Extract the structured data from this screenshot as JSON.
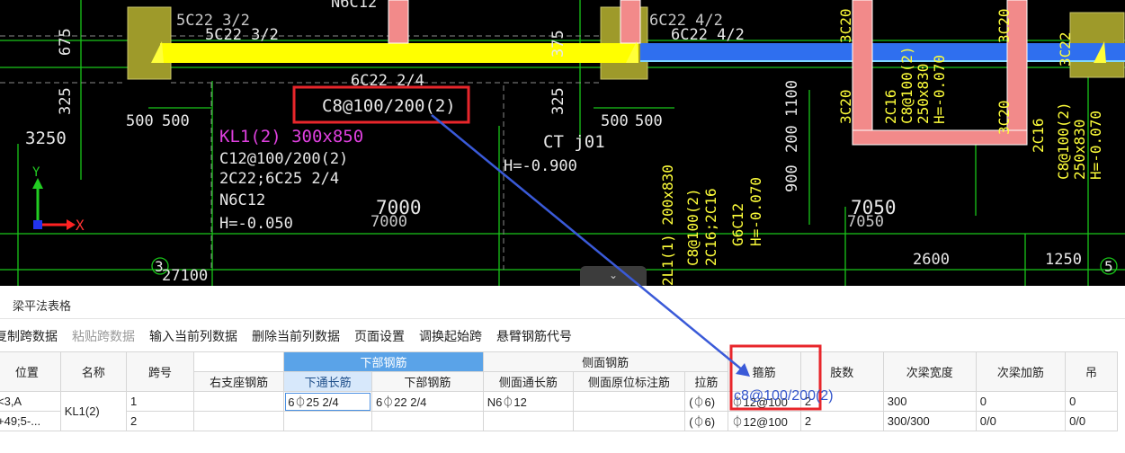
{
  "cad": {
    "labels": {
      "l1": "5C22 3/2",
      "l2": "5C22 3/2",
      "l3": "6C22 4/2",
      "l4": "6C22 4/2",
      "l5": "675",
      "l6": "325",
      "l7": "3250",
      "l8": "500",
      "l9": "500",
      "l10": "500",
      "l11": "500",
      "l12": "6C22 2/4",
      "l13": "C8@100/200(2)",
      "l14": "KL1(2) 300x850",
      "l15": "C12@100/200(2)",
      "l16": "2C22;6C25 2/4",
      "l17": "N6C12",
      "l18": "H=-0.050",
      "l19": "7000",
      "l20": "7000",
      "l21": "CT j01",
      "l22": "H=-0.900",
      "l23": "375",
      "l24": "325",
      "l25": "1100",
      "l26": "200",
      "l27": "900",
      "l28": "7050",
      "l29": "7050",
      "l30": "2600",
      "l31": "1250",
      "l32": "27100",
      "l33": "3",
      "l34": "5",
      "l35": "N6C12",
      "l36": "3C20",
      "l37": "3C20",
      "l38": "3C22",
      "l39": "2C16",
      "l40": "C8@100(2)",
      "l41": "250x830",
      "l42": "H=-0.070",
      "l43": "G6C12",
      "l44": "H=-0.070",
      "l45": "2C16;2C16",
      "l46": "C8@100(2)",
      "l47": "2L1(1) 200x830",
      "l48": "X",
      "l49": "Y"
    }
  },
  "panel": {
    "title": "梁平法表格",
    "toolbar": [
      "复制跨数据",
      "粘贴跨数据",
      "输入当前列数据",
      "删除当前列数据",
      "页面设置",
      "调换起始跨",
      "悬臂钢筋代号"
    ],
    "group_headers": {
      "bottom": "下部钢筋",
      "side": "侧面钢筋"
    },
    "columns": [
      "位置",
      "名称",
      "跨号",
      "右支座钢筋",
      "下通长筋",
      "下部钢筋",
      "侧面通长筋",
      "侧面原位标注筋",
      "拉筋",
      "箍筋",
      "肢数",
      "次梁宽度",
      "次梁加筋",
      "吊"
    ],
    "rows": [
      {
        "pos": "<3,A",
        "name": "KL1(2)",
        "span": "1",
        "right": "",
        "bott_cont": "6⏀25 2/4",
        "bott": "6⏀22 2/4",
        "side_cont": "N6⏀12",
        "side_orig": "",
        "tie": "(⏀6)",
        "stirrup": "⏀12@100",
        "legs": "2",
        "sec_w": "300",
        "sec_add": "0",
        "hang": "0"
      },
      {
        "pos": "+49;5-...",
        "name": "",
        "span": "2",
        "right": "",
        "bott_cont": "",
        "bott": "",
        "side_cont": "",
        "side_orig": "",
        "tie": "(⏀6)",
        "stirrup": "⏀12@100",
        "legs": "2",
        "sec_w": "300/300",
        "sec_add": "0/0",
        "hang": "0/0"
      }
    ],
    "stirrup_overlay": "c8@100/200(2)"
  },
  "colors": {
    "highlight_box": "#e8262b",
    "arrow": "#3a5ad8",
    "beam_yellow": "#ffff00",
    "beam_blue": "#3c78ff"
  }
}
